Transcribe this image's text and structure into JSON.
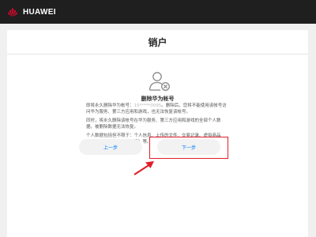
{
  "topbar": {
    "brand": "HUAWEI"
  },
  "card": {
    "title": "销户",
    "subtitle": "删除华为帐号",
    "paragraphs": [
      {
        "lead": "即将永久删除华为帐号：",
        "masked": "15*****0095",
        "rest": "。删除后，您将不能使用该帐号访问华为服务、第三方应用和游戏，也无法恢复该帐号。"
      },
      {
        "text": "同时，将永久删除该帐号在华为服务、第三方应用和游戏的全部个人数据。被删除数据无法恢复。"
      },
      {
        "text": "个人数据包括但不限于：个人信息、上传的文件、交易记录、虚拟商品（内容、服务、卡券和道具）等。"
      }
    ]
  },
  "buttons": {
    "prev": "上一步",
    "next": "下一步"
  },
  "colors": {
    "topbar": "#1f1f1f",
    "brand_red": "#cf0a2c",
    "link": "#007dff",
    "annotation": "#e0202a"
  },
  "icons": [
    "huawei-logo-icon",
    "user-delete-icon",
    "annotation-arrow-icon"
  ]
}
